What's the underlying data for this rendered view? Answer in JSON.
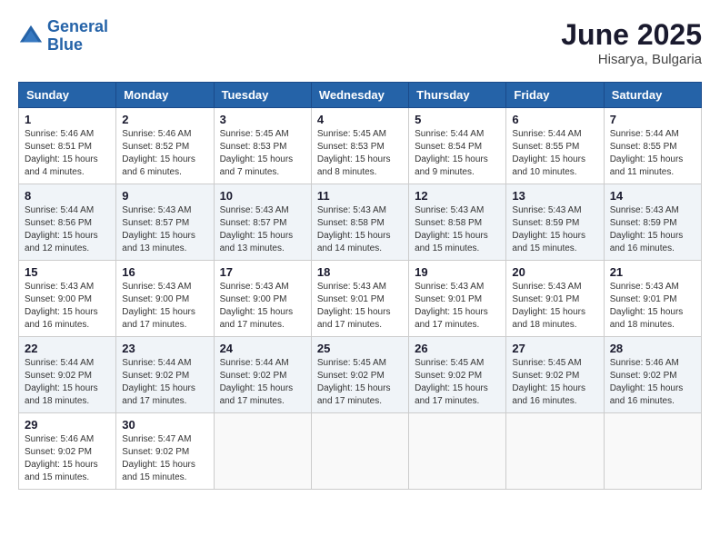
{
  "header": {
    "logo_line1": "General",
    "logo_line2": "Blue",
    "month_title": "June 2025",
    "location": "Hisarya, Bulgaria"
  },
  "weekdays": [
    "Sunday",
    "Monday",
    "Tuesday",
    "Wednesday",
    "Thursday",
    "Friday",
    "Saturday"
  ],
  "weeks": [
    [
      {
        "day": "1",
        "sunrise": "Sunrise: 5:46 AM",
        "sunset": "Sunset: 8:51 PM",
        "daylight": "Daylight: 15 hours and 4 minutes."
      },
      {
        "day": "2",
        "sunrise": "Sunrise: 5:46 AM",
        "sunset": "Sunset: 8:52 PM",
        "daylight": "Daylight: 15 hours and 6 minutes."
      },
      {
        "day": "3",
        "sunrise": "Sunrise: 5:45 AM",
        "sunset": "Sunset: 8:53 PM",
        "daylight": "Daylight: 15 hours and 7 minutes."
      },
      {
        "day": "4",
        "sunrise": "Sunrise: 5:45 AM",
        "sunset": "Sunset: 8:53 PM",
        "daylight": "Daylight: 15 hours and 8 minutes."
      },
      {
        "day": "5",
        "sunrise": "Sunrise: 5:44 AM",
        "sunset": "Sunset: 8:54 PM",
        "daylight": "Daylight: 15 hours and 9 minutes."
      },
      {
        "day": "6",
        "sunrise": "Sunrise: 5:44 AM",
        "sunset": "Sunset: 8:55 PM",
        "daylight": "Daylight: 15 hours and 10 minutes."
      },
      {
        "day": "7",
        "sunrise": "Sunrise: 5:44 AM",
        "sunset": "Sunset: 8:55 PM",
        "daylight": "Daylight: 15 hours and 11 minutes."
      }
    ],
    [
      {
        "day": "8",
        "sunrise": "Sunrise: 5:44 AM",
        "sunset": "Sunset: 8:56 PM",
        "daylight": "Daylight: 15 hours and 12 minutes."
      },
      {
        "day": "9",
        "sunrise": "Sunrise: 5:43 AM",
        "sunset": "Sunset: 8:57 PM",
        "daylight": "Daylight: 15 hours and 13 minutes."
      },
      {
        "day": "10",
        "sunrise": "Sunrise: 5:43 AM",
        "sunset": "Sunset: 8:57 PM",
        "daylight": "Daylight: 15 hours and 13 minutes."
      },
      {
        "day": "11",
        "sunrise": "Sunrise: 5:43 AM",
        "sunset": "Sunset: 8:58 PM",
        "daylight": "Daylight: 15 hours and 14 minutes."
      },
      {
        "day": "12",
        "sunrise": "Sunrise: 5:43 AM",
        "sunset": "Sunset: 8:58 PM",
        "daylight": "Daylight: 15 hours and 15 minutes."
      },
      {
        "day": "13",
        "sunrise": "Sunrise: 5:43 AM",
        "sunset": "Sunset: 8:59 PM",
        "daylight": "Daylight: 15 hours and 15 minutes."
      },
      {
        "day": "14",
        "sunrise": "Sunrise: 5:43 AM",
        "sunset": "Sunset: 8:59 PM",
        "daylight": "Daylight: 15 hours and 16 minutes."
      }
    ],
    [
      {
        "day": "15",
        "sunrise": "Sunrise: 5:43 AM",
        "sunset": "Sunset: 9:00 PM",
        "daylight": "Daylight: 15 hours and 16 minutes."
      },
      {
        "day": "16",
        "sunrise": "Sunrise: 5:43 AM",
        "sunset": "Sunset: 9:00 PM",
        "daylight": "Daylight: 15 hours and 17 minutes."
      },
      {
        "day": "17",
        "sunrise": "Sunrise: 5:43 AM",
        "sunset": "Sunset: 9:00 PM",
        "daylight": "Daylight: 15 hours and 17 minutes."
      },
      {
        "day": "18",
        "sunrise": "Sunrise: 5:43 AM",
        "sunset": "Sunset: 9:01 PM",
        "daylight": "Daylight: 15 hours and 17 minutes."
      },
      {
        "day": "19",
        "sunrise": "Sunrise: 5:43 AM",
        "sunset": "Sunset: 9:01 PM",
        "daylight": "Daylight: 15 hours and 17 minutes."
      },
      {
        "day": "20",
        "sunrise": "Sunrise: 5:43 AM",
        "sunset": "Sunset: 9:01 PM",
        "daylight": "Daylight: 15 hours and 18 minutes."
      },
      {
        "day": "21",
        "sunrise": "Sunrise: 5:43 AM",
        "sunset": "Sunset: 9:01 PM",
        "daylight": "Daylight: 15 hours and 18 minutes."
      }
    ],
    [
      {
        "day": "22",
        "sunrise": "Sunrise: 5:44 AM",
        "sunset": "Sunset: 9:02 PM",
        "daylight": "Daylight: 15 hours and 18 minutes."
      },
      {
        "day": "23",
        "sunrise": "Sunrise: 5:44 AM",
        "sunset": "Sunset: 9:02 PM",
        "daylight": "Daylight: 15 hours and 17 minutes."
      },
      {
        "day": "24",
        "sunrise": "Sunrise: 5:44 AM",
        "sunset": "Sunset: 9:02 PM",
        "daylight": "Daylight: 15 hours and 17 minutes."
      },
      {
        "day": "25",
        "sunrise": "Sunrise: 5:45 AM",
        "sunset": "Sunset: 9:02 PM",
        "daylight": "Daylight: 15 hours and 17 minutes."
      },
      {
        "day": "26",
        "sunrise": "Sunrise: 5:45 AM",
        "sunset": "Sunset: 9:02 PM",
        "daylight": "Daylight: 15 hours and 17 minutes."
      },
      {
        "day": "27",
        "sunrise": "Sunrise: 5:45 AM",
        "sunset": "Sunset: 9:02 PM",
        "daylight": "Daylight: 15 hours and 16 minutes."
      },
      {
        "day": "28",
        "sunrise": "Sunrise: 5:46 AM",
        "sunset": "Sunset: 9:02 PM",
        "daylight": "Daylight: 15 hours and 16 minutes."
      }
    ],
    [
      {
        "day": "29",
        "sunrise": "Sunrise: 5:46 AM",
        "sunset": "Sunset: 9:02 PM",
        "daylight": "Daylight: 15 hours and 15 minutes."
      },
      {
        "day": "30",
        "sunrise": "Sunrise: 5:47 AM",
        "sunset": "Sunset: 9:02 PM",
        "daylight": "Daylight: 15 hours and 15 minutes."
      },
      null,
      null,
      null,
      null,
      null
    ]
  ]
}
